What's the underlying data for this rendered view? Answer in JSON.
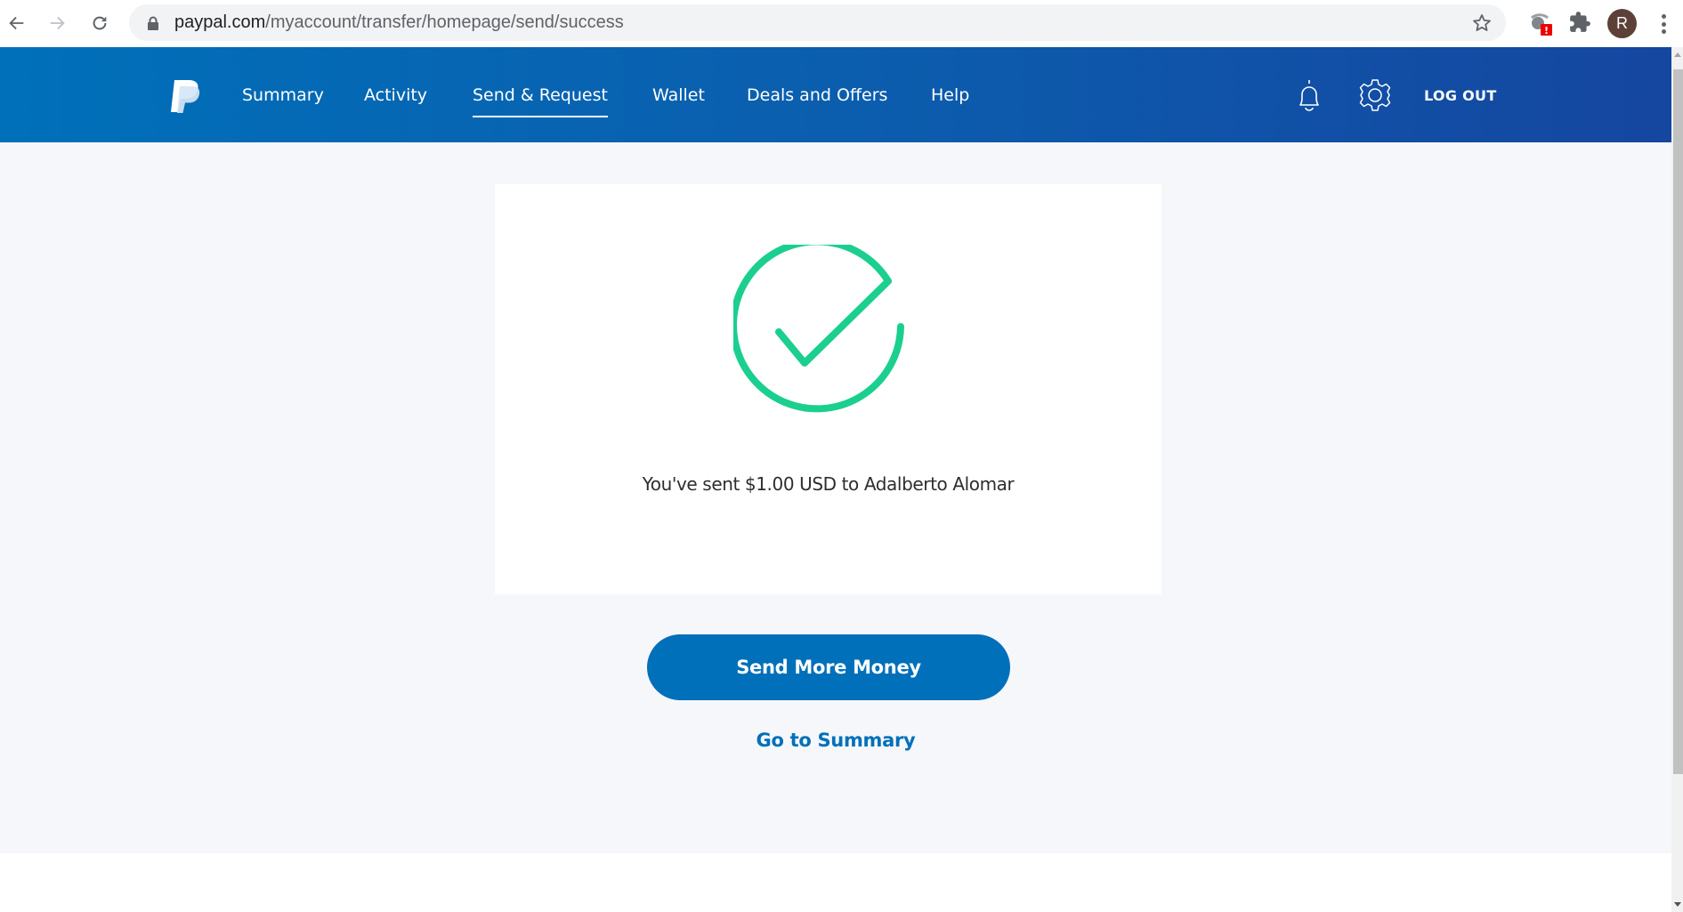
{
  "browser": {
    "url_host": "paypal.com",
    "url_path": "/myaccount/transfer/homepage/send/success",
    "profile_initial": "R",
    "extension_badge": "!",
    "icons": {
      "back": "arrow-left-icon",
      "forward": "arrow-right-icon",
      "reload": "reload-icon",
      "lock": "lock-icon",
      "bookmark": "star-icon",
      "extension": "shield-extension-icon",
      "extensions": "puzzle-icon",
      "menu": "kebab-menu-icon"
    }
  },
  "header": {
    "brand": "PayPal",
    "nav": [
      {
        "label": "Summary",
        "active": false
      },
      {
        "label": "Activity",
        "active": false
      },
      {
        "label": "Send & Request",
        "active": true
      },
      {
        "label": "Wallet",
        "active": false
      },
      {
        "label": "Deals and Offers",
        "active": false
      },
      {
        "label": "Help",
        "active": false
      }
    ],
    "notifications_icon": "bell-icon",
    "settings_icon": "gear-icon",
    "logout_label": "LOG OUT"
  },
  "success": {
    "icon": "success-checkmark-icon",
    "message": "You've sent $1.00 USD to Adalberto Alomar",
    "amount": "$1.00",
    "currency": "USD",
    "recipient": "Adalberto Alomar"
  },
  "actions": {
    "primary_label": "Send More Money",
    "secondary_label": "Go to Summary"
  },
  "colors": {
    "brand_blue": "#0070ba",
    "header_gradient_end": "#1546a0",
    "success_green": "#1bcf8f",
    "page_background": "#f5f7fa"
  }
}
